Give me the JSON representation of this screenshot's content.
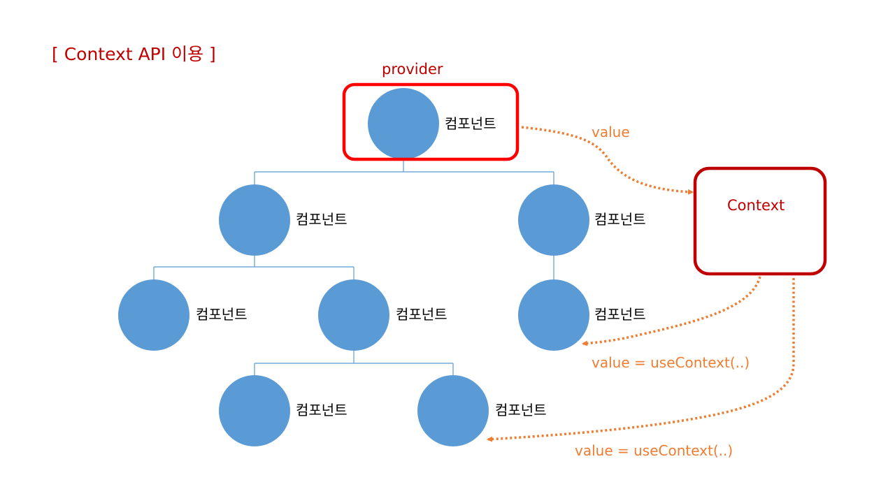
{
  "title": "[ Context API 이용 ]",
  "colors": {
    "node": "#5b9bd5",
    "tree_line": "#5b9bd5",
    "provider_box": "#ff0000",
    "context_box": "#c00000",
    "title_text": "#c00000",
    "flow": "#ed7d31"
  },
  "provider_label": "provider",
  "context_label": "Context",
  "nodes": [
    {
      "id": "root",
      "label": "컴포넌트"
    },
    {
      "id": "left",
      "label": "컴포넌트"
    },
    {
      "id": "right",
      "label": "컴포넌트"
    },
    {
      "id": "left-left",
      "label": "컴포넌트"
    },
    {
      "id": "left-right",
      "label": "컴포넌트"
    },
    {
      "id": "right-child",
      "label": "컴포넌트"
    },
    {
      "id": "grandchild-left",
      "label": "컴포넌트"
    },
    {
      "id": "grandchild-right",
      "label": "컴포넌트"
    }
  ],
  "edges": [
    {
      "from": "root",
      "to": "left"
    },
    {
      "from": "root",
      "to": "right"
    },
    {
      "from": "left",
      "to": "left-left"
    },
    {
      "from": "left",
      "to": "left-right"
    },
    {
      "from": "right",
      "to": "right-child"
    },
    {
      "from": "left-right",
      "to": "grandchild-left"
    },
    {
      "from": "left-right",
      "to": "grandchild-right"
    }
  ],
  "flows": [
    {
      "from": "root",
      "to": "context",
      "label": "value"
    },
    {
      "from": "context",
      "to": "right-child",
      "label": "value = useContext(..)"
    },
    {
      "from": "context",
      "to": "grandchild-right",
      "label": "value = useContext(..)"
    }
  ]
}
